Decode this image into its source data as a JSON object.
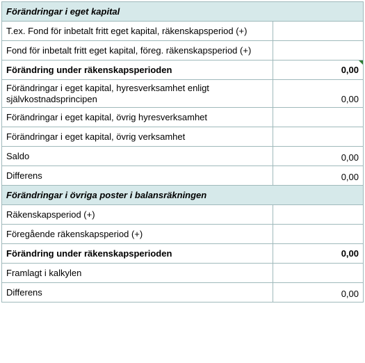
{
  "section1": {
    "title": "Förändringar i eget kapital",
    "rows": [
      {
        "label": "T.ex. Fond för inbetalt fritt eget kapital, räkenskapsperiod (+)",
        "value": ""
      },
      {
        "label": "Fond för inbetalt fritt eget kapital, föreg. räkenskapsperiod (+)",
        "value": ""
      },
      {
        "label": "Förändring under räkenskapsperioden",
        "value": "0,00",
        "bold": true,
        "indicator": true
      },
      {
        "label": "Förändringar i eget kapital, hyresverksamhet enligt självkostnadsprincipen",
        "value": "0,00"
      },
      {
        "label": "Förändringar i eget kapital, övrig hyresverksamhet",
        "value": ""
      },
      {
        "label": "Förändringar i eget kapital, övrig verksamhet",
        "value": ""
      },
      {
        "label": "Saldo",
        "value": "0,00"
      },
      {
        "label": "Differens",
        "value": "0,00"
      }
    ]
  },
  "section2": {
    "title": "Förändringar i övriga poster i balansräkningen",
    "rows": [
      {
        "label": "Räkenskapsperiod (+)",
        "value": ""
      },
      {
        "label": "Föregående räkenskapsperiod (+)",
        "value": ""
      },
      {
        "label": "Förändring under räkenskapsperioden",
        "value": "0,00",
        "bold": true
      },
      {
        "label": "Framlagt i kalkylen",
        "value": ""
      },
      {
        "label": "Differens",
        "value": "0,00"
      }
    ]
  }
}
